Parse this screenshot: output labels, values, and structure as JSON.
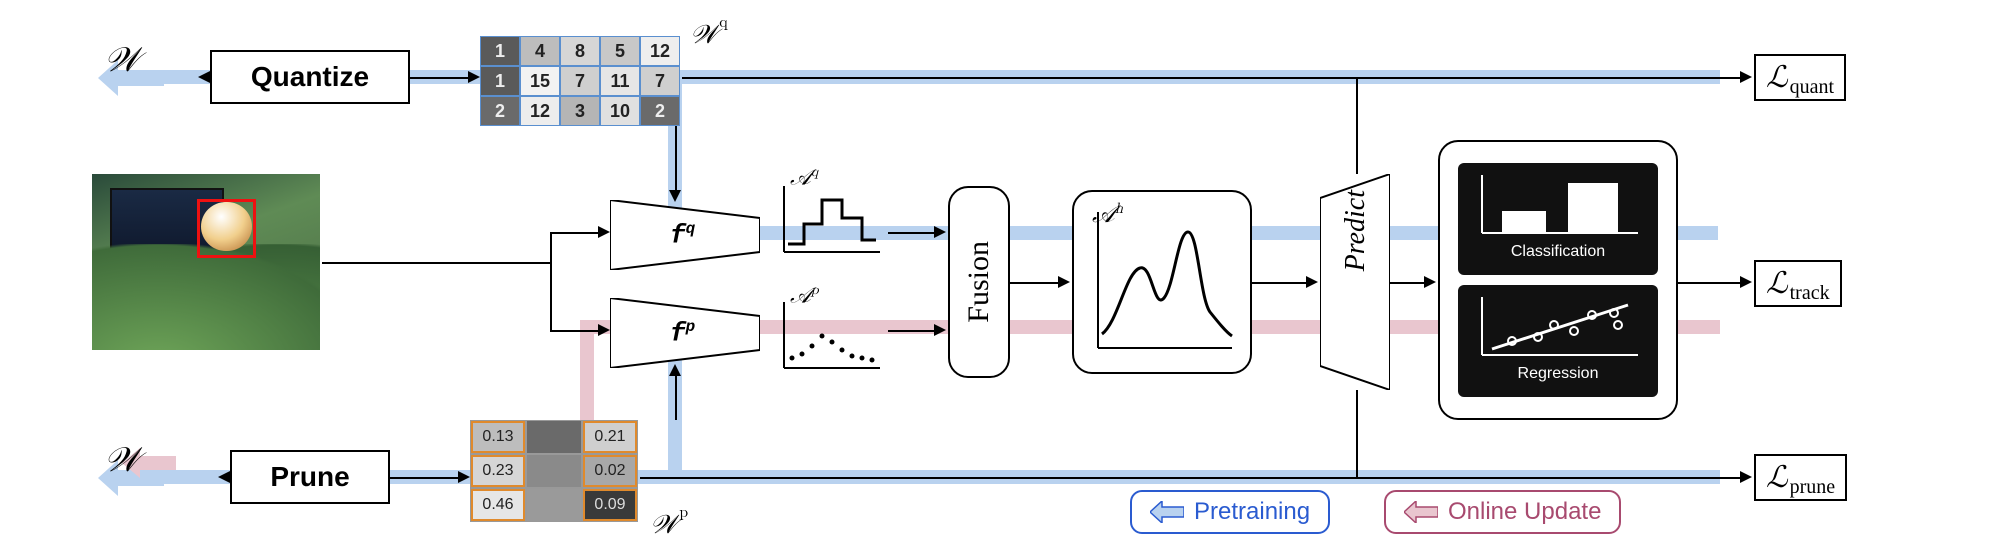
{
  "ops": {
    "quantize": "Quantize",
    "prune": "Prune"
  },
  "weights_symbol": "𝒲",
  "wq_label": "𝒲",
  "wq_script": "q",
  "wp_label": "𝒲",
  "wp_script": "p",
  "quant_matrix": [
    [
      1,
      4,
      8,
      5,
      12
    ],
    [
      1,
      15,
      7,
      11,
      7
    ],
    [
      2,
      12,
      3,
      10,
      2
    ]
  ],
  "prune_matrix": [
    [
      "0.13",
      "",
      "0.21"
    ],
    [
      "0.23",
      "",
      "0.02"
    ],
    [
      "0.46",
      "",
      "0.09"
    ]
  ],
  "feat_q": "f",
  "feat_q_sup": "q",
  "feat_p": "f",
  "feat_p_sup": "p",
  "act_q": "𝒜",
  "act_q_sup": "q",
  "act_p": "𝒜",
  "act_p_sup": "p",
  "act_h": "𝒜",
  "act_h_sup": "h",
  "fusion": "Fusion",
  "predict": "Predict",
  "cls_label": "Classification",
  "reg_label": "Regression",
  "loss_quant_sym": "ℒ",
  "loss_quant_sub": "quant",
  "loss_track_sym": "ℒ",
  "loss_track_sub": "track",
  "loss_prune_sym": "ℒ",
  "loss_prune_sub": "prune",
  "legend_pretrain": "Pretraining",
  "legend_online": "Online Update",
  "chart_data": {
    "type": "diagram",
    "description": "Neural network architecture diagram with two compression branches (Quantize producing W^q, Prune producing W^p) feeding feature extractors f^q and f^p on an input image, producing activation maps A^q and A^p which are Fused into A^h, then passed through a Predict head yielding Classification and Regression outputs. Three losses: L_quant (from quantized path), L_track (from prediction head), L_prune (from pruned path). Blue flow = Pretraining gradient path, pink/mauve flow = Online Update gradient path."
  }
}
